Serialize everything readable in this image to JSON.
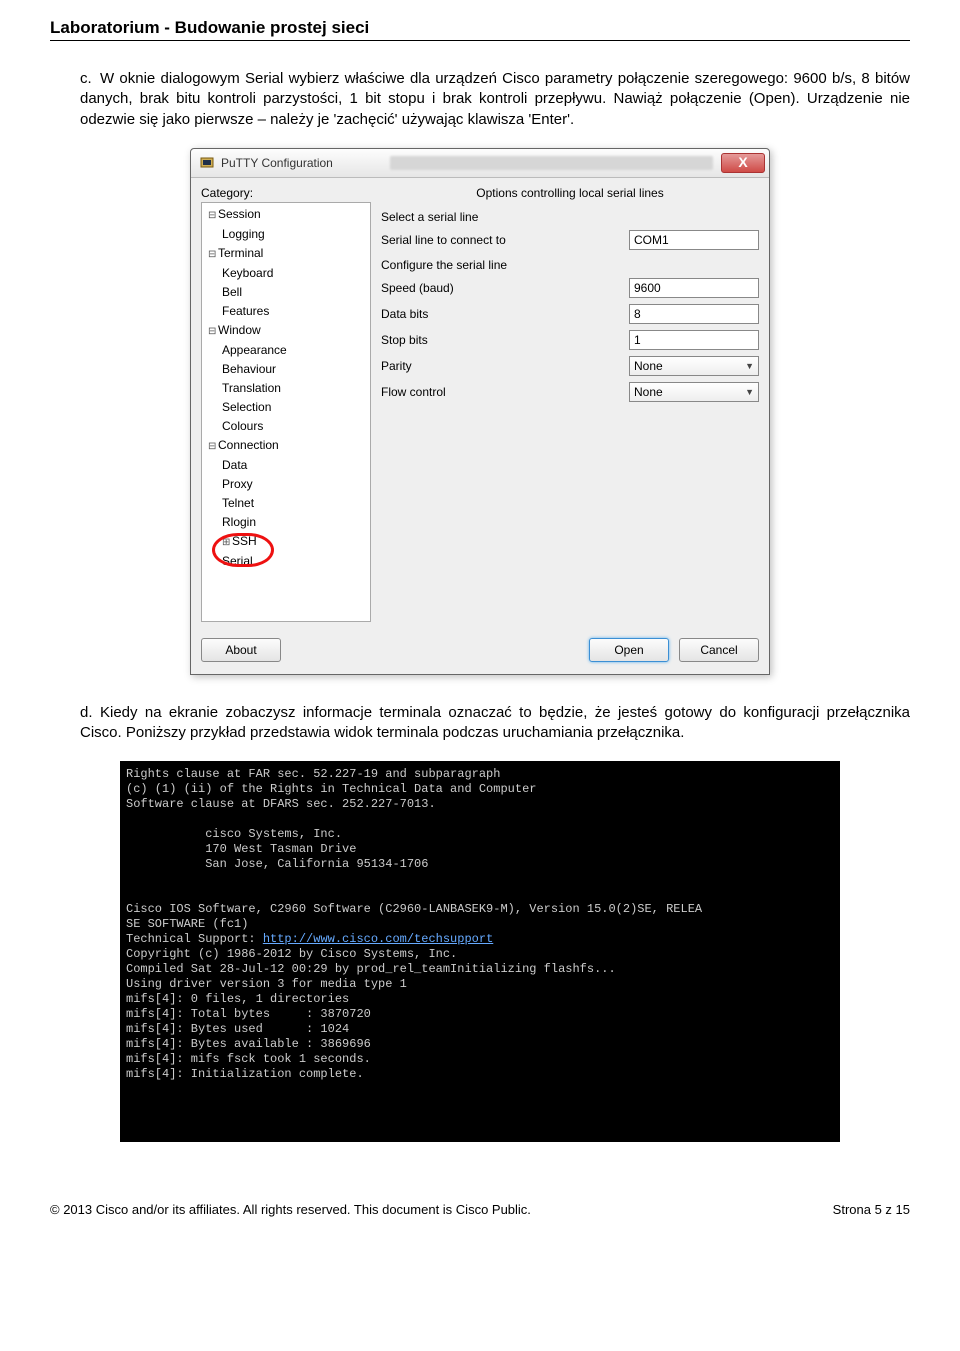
{
  "doc": {
    "title": "Laboratorium - Budowanie prostej sieci",
    "para_c_letter": "c.",
    "para_c": "W oknie dialogowym Serial wybierz właściwe dla urządzeń Cisco parametry połączenie szeregowego: 9600 b/s, 8 bitów danych, brak bitu kontroli parzystości, 1 bit stopu i brak kontroli przepływu. Nawiąż połączenie (Open). Urządzenie nie odezwie się jako pierwsze – należy je 'zachęcić' używając klawisza 'Enter'.",
    "para_d_letter": "d.",
    "para_d": "Kiedy na ekranie zobaczysz informacje terminala oznaczać to będzie, że jesteś gotowy do konfiguracji przełącznika Cisco. Poniższy przykład przedstawia widok terminala podczas uruchamiania przełącznika.",
    "footer_left": "© 2013 Cisco and/or its affiliates. All rights reserved. This document is Cisco Public.",
    "footer_right": "Strona 5 z 15"
  },
  "putty": {
    "window_title": "PuTTY Configuration",
    "close_glyph": "X",
    "category_label": "Category:",
    "tree": {
      "session": "Session",
      "logging": "Logging",
      "terminal": "Terminal",
      "keyboard": "Keyboard",
      "bell": "Bell",
      "features": "Features",
      "window": "Window",
      "appearance": "Appearance",
      "behaviour": "Behaviour",
      "translation": "Translation",
      "selection": "Selection",
      "colours": "Colours",
      "connection": "Connection",
      "data": "Data",
      "proxy": "Proxy",
      "telnet": "Telnet",
      "rlogin": "Rlogin",
      "ssh": "SSH",
      "serial": "Serial"
    },
    "panel_title": "Options controlling local serial lines",
    "select_serial_label": "Select a serial line",
    "serial_line_label": "Serial line to connect to",
    "serial_line_value": "COM1",
    "configure_label": "Configure the serial line",
    "speed_label": "Speed (baud)",
    "speed_value": "9600",
    "databits_label": "Data bits",
    "databits_value": "8",
    "stopbits_label": "Stop bits",
    "stopbits_value": "1",
    "parity_label": "Parity",
    "parity_value": "None",
    "flow_label": "Flow control",
    "flow_value": "None",
    "btn_about": "About",
    "btn_open": "Open",
    "btn_cancel": "Cancel"
  },
  "terminal": {
    "line1": "Rights clause at FAR sec. 52.227-19 and subparagraph",
    "line2": "(c) (1) (ii) of the Rights in Technical Data and Computer",
    "line3": "Software clause at DFARS sec. 252.227-7013.",
    "line4": "           cisco Systems, Inc.",
    "line5": "           170 West Tasman Drive",
    "line6": "           San Jose, California 95134-1706",
    "line7": "Cisco IOS Software, C2960 Software (C2960-LANBASEK9-M), Version 15.0(2)SE, RELEA",
    "line8": "SE SOFTWARE (fc1)",
    "line9a": "Technical Support: ",
    "line9b": "http://www.cisco.com/techsupport",
    "line10": "Copyright (c) 1986-2012 by Cisco Systems, Inc.",
    "line11": "Compiled Sat 28-Jul-12 00:29 by prod_rel_teamInitializing flashfs...",
    "line12": "Using driver version 3 for media type 1",
    "line13": "mifs[4]: 0 files, 1 directories",
    "line14": "mifs[4]: Total bytes     : 3870720",
    "line15": "mifs[4]: Bytes used      : 1024",
    "line16": "mifs[4]: Bytes available : 3869696",
    "line17": "mifs[4]: mifs fsck took 1 seconds.",
    "line18": "mifs[4]: Initialization complete."
  }
}
